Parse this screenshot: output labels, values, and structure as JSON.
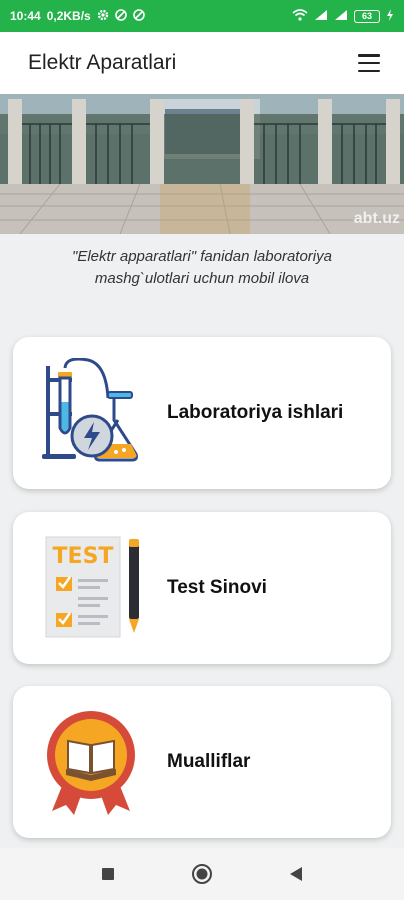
{
  "status_bar": {
    "time": "10:44",
    "net_speed": "0,2KB/s",
    "battery": "63"
  },
  "app_bar": {
    "title": "Elektr Aparatlari",
    "menu_icon": "hamburger-menu-icon"
  },
  "banner": {
    "watermark": "abt.uz"
  },
  "subtitle": "\"Elektr apparatlari\" fanidan laboratoriya mashg`ulotlari uchun mobil ilova",
  "cards": [
    {
      "label": "Laboratoriya ishlari",
      "icon": "laboratory-flask-icon"
    },
    {
      "label": "Test Sinovi",
      "icon": "test-checklist-icon"
    },
    {
      "label": "Mualliflar",
      "icon": "book-badge-icon"
    }
  ],
  "colors": {
    "status_bar": "#24b24b",
    "accent_orange": "#f5a623",
    "accent_blue": "#2f4a8a"
  }
}
